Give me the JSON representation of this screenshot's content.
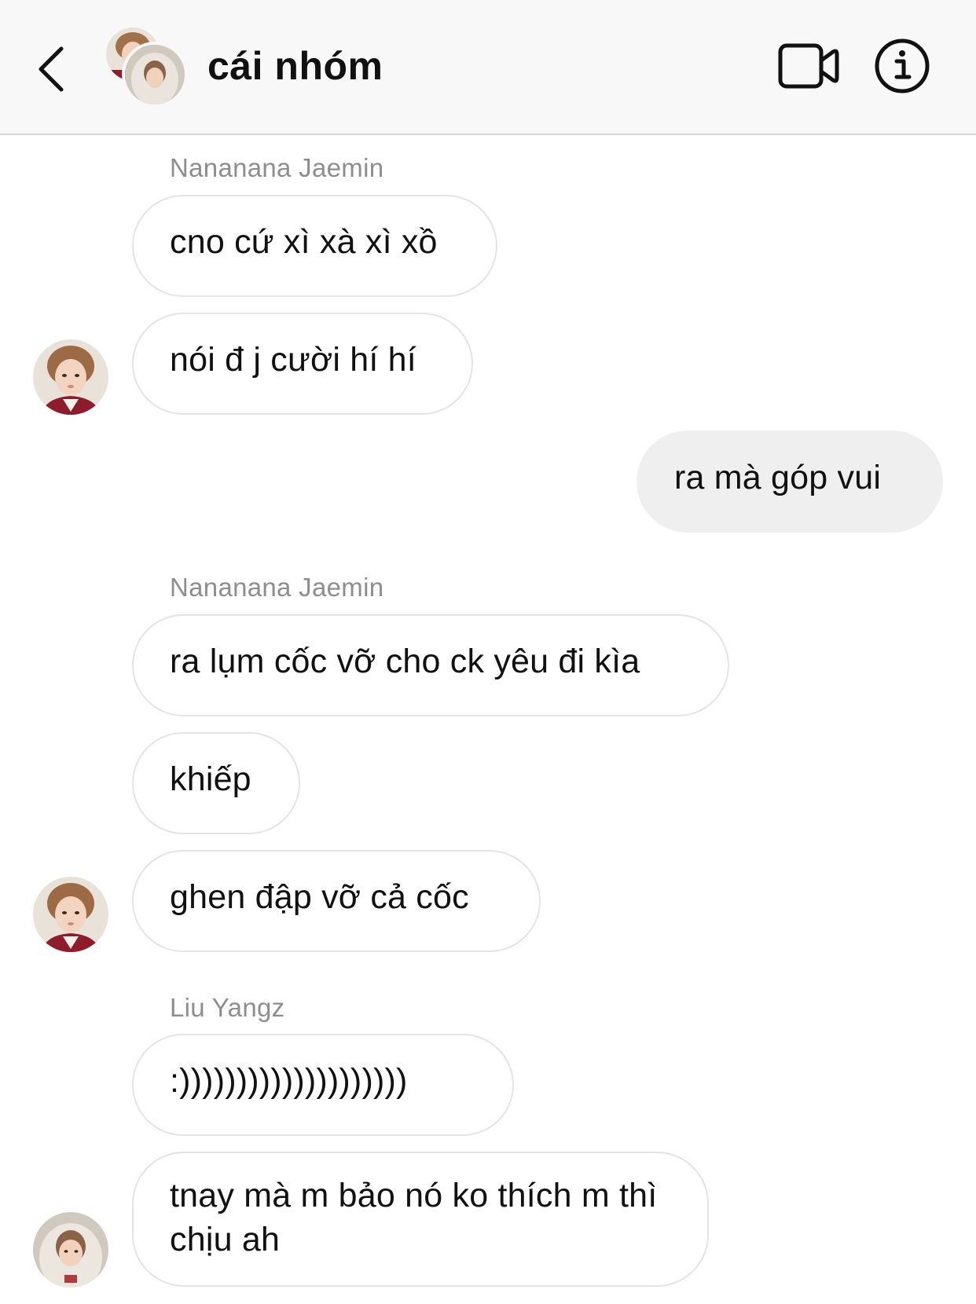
{
  "header": {
    "title": "cái nhóm",
    "back_icon": "chevron-left-icon",
    "video_icon": "video-camera-icon",
    "info_icon": "info-icon"
  },
  "messages": [
    {
      "sender": "Nananana Jaemin",
      "text": "cno cứ xì xà xì xồ",
      "direction": "incoming"
    },
    {
      "text": "nói đ j cười hí hí",
      "direction": "incoming"
    },
    {
      "text": "ra mà góp vui",
      "direction": "outgoing"
    },
    {
      "sender": "Nananana Jaemin",
      "text": "ra lụm cốc vỡ cho ck yêu đi kìa",
      "direction": "incoming"
    },
    {
      "text": "khiếp",
      "direction": "incoming"
    },
    {
      "text": "ghen đập vỡ cả cốc",
      "direction": "incoming"
    },
    {
      "sender": "Liu Yangz",
      "text": ":))))))))))))))))))))",
      "direction": "incoming"
    },
    {
      "text": "tnay mà m bảo nó ko thích m thì chịu ah",
      "direction": "incoming"
    }
  ],
  "colors": {
    "header_bg": "#f8f8f8",
    "incoming_bubble_border": "#e4e4e4",
    "outgoing_bubble_bg": "#efefef",
    "sender_name": "#8e8e8e"
  }
}
